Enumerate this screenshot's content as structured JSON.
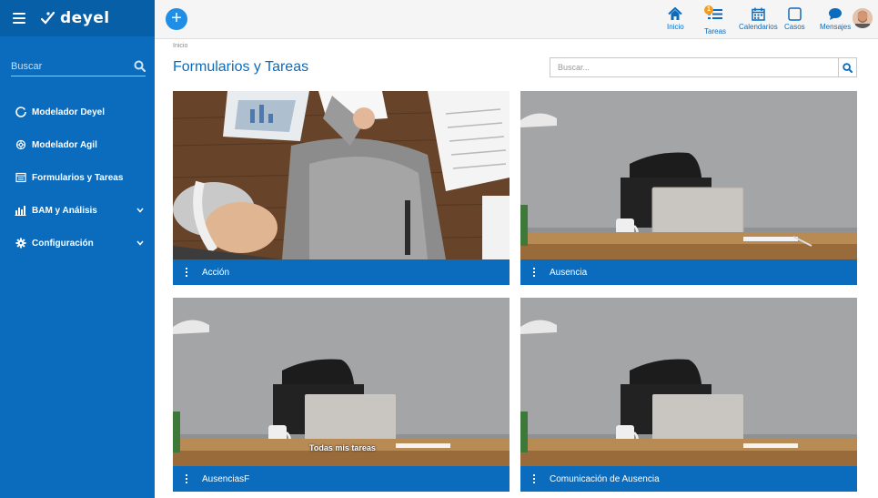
{
  "brand": {
    "logo_text": "deyel"
  },
  "sidebar": {
    "search_placeholder": "Buscar",
    "items": [
      {
        "label": "Modelador Deyel",
        "icon": "circle-refresh-icon",
        "expandable": false
      },
      {
        "label": "Modelador Agil",
        "icon": "gear-outline-icon",
        "expandable": false
      },
      {
        "label": "Formularios y Tareas",
        "icon": "form-icon",
        "expandable": false
      },
      {
        "label": "BAM y Análisis",
        "icon": "bar-chart-icon",
        "expandable": true
      },
      {
        "label": "Configuración",
        "icon": "gear-icon",
        "expandable": true
      }
    ]
  },
  "topbar": {
    "add_label": "+",
    "items": [
      {
        "label": "Inicio",
        "icon": "home-icon"
      },
      {
        "label": "Tareas",
        "icon": "tasks-icon",
        "badge": "1"
      },
      {
        "label": "Calendarios",
        "icon": "calendar-icon"
      },
      {
        "label": "Casos",
        "icon": "square-icon"
      },
      {
        "label": "Mensajes",
        "icon": "chat-bubble-icon"
      }
    ]
  },
  "main": {
    "breadcrumb": "Inicio",
    "title": "Formularios y Tareas",
    "search_placeholder": "Buscar...",
    "cards": [
      {
        "label": "Acción",
        "image": "office-desk-photo"
      },
      {
        "label": "Ausencia",
        "image": "empty-desk-laptop-photo"
      },
      {
        "label": "AusenciasF",
        "image": "empty-desk-laptop-photo",
        "tooltip": "Todas mis tareas"
      },
      {
        "label": "Comunicación de Ausencia",
        "image": "empty-desk-laptop-photo"
      }
    ]
  },
  "colors": {
    "primary": "#0b6cbd",
    "sidebar_dark": "#075fa8",
    "accent_button": "#1e8ee6",
    "badge": "#f29b21"
  }
}
